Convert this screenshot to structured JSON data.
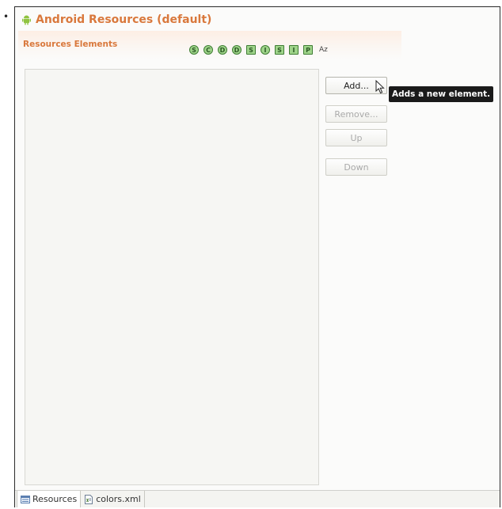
{
  "bullet": "•",
  "editor": {
    "title": "Android Resources (default)",
    "section_title": "Resources Elements",
    "type_icons": [
      {
        "glyph": "S",
        "shape": "round",
        "name": "string-type-icon"
      },
      {
        "glyph": "C",
        "shape": "round",
        "name": "color-type-icon"
      },
      {
        "glyph": "D",
        "shape": "round",
        "name": "dimension-type-icon"
      },
      {
        "glyph": "D",
        "shape": "round",
        "name": "drawable-type-icon"
      },
      {
        "glyph": "S",
        "shape": "square",
        "name": "style-type-icon"
      },
      {
        "glyph": "I",
        "shape": "round",
        "name": "item-type-icon"
      },
      {
        "glyph": "S",
        "shape": "square",
        "name": "string-array-type-icon"
      },
      {
        "glyph": "I",
        "shape": "square",
        "name": "integer-array-type-icon"
      },
      {
        "glyph": "P",
        "shape": "square",
        "name": "plurals-type-icon"
      }
    ],
    "sort_label": "Az",
    "buttons": {
      "add": "Add...",
      "remove": "Remove...",
      "up": "Up",
      "down": "Down"
    },
    "tooltip": "Adds a new element.",
    "tabs": [
      {
        "label": "Resources",
        "icon": "resources-icon"
      },
      {
        "label": "colors.xml",
        "icon": "xml-file-icon"
      }
    ]
  },
  "colors": {
    "title": "#d9783c",
    "icon_green": "#9fd48a",
    "tooltip_bg": "#1a1a1a"
  }
}
